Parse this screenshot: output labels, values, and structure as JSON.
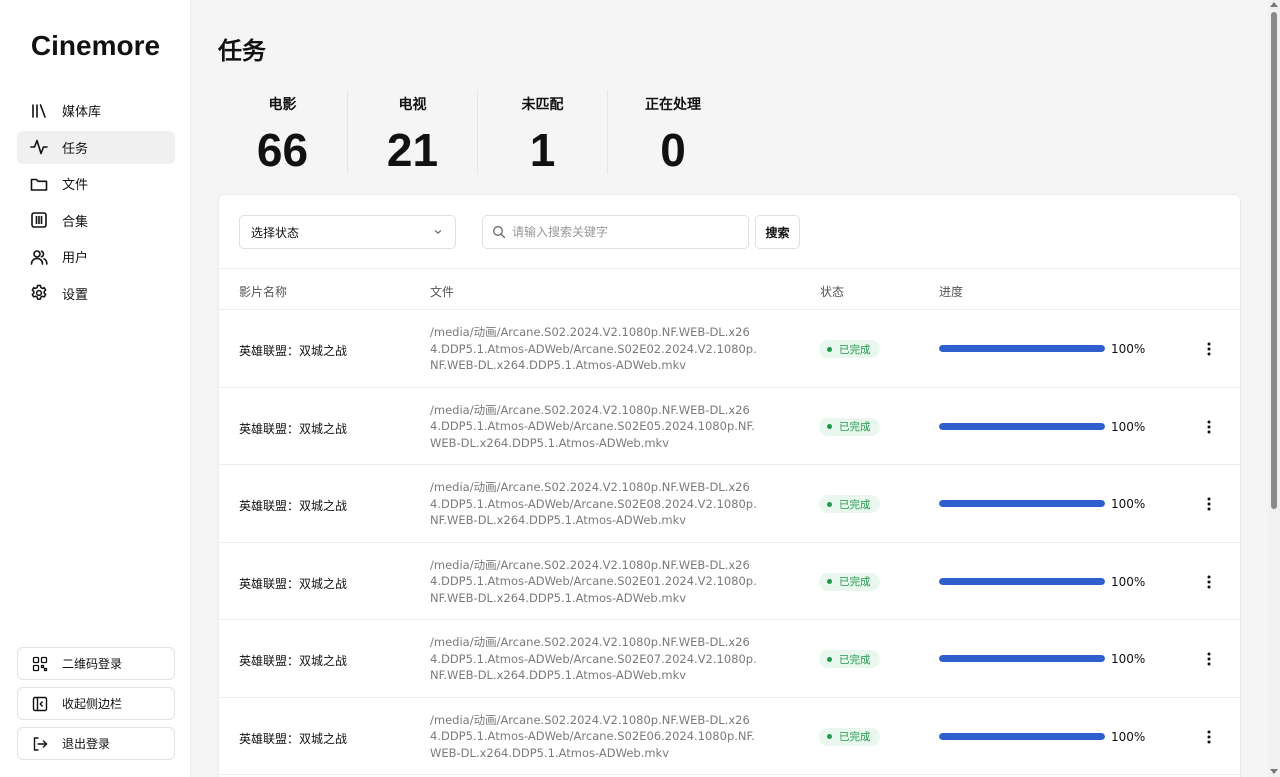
{
  "app": {
    "brand": "Cinemore"
  },
  "sidebar": {
    "items": [
      {
        "label": "媒体库",
        "icon": "library-icon",
        "active": false
      },
      {
        "label": "任务",
        "icon": "activity-icon",
        "active": true
      },
      {
        "label": "文件",
        "icon": "folder-icon",
        "active": false
      },
      {
        "label": "合集",
        "icon": "collection-icon",
        "active": false
      },
      {
        "label": "用户",
        "icon": "users-icon",
        "active": false
      },
      {
        "label": "设置",
        "icon": "gear-icon",
        "active": false
      }
    ],
    "buttons": [
      {
        "label": "二维码登录",
        "icon": "qrcode-icon"
      },
      {
        "label": "收起侧边栏",
        "icon": "collapse-sidebar-icon"
      },
      {
        "label": "退出登录",
        "icon": "logout-icon"
      }
    ]
  },
  "page": {
    "title": "任务"
  },
  "stats": [
    {
      "label": "电影",
      "value": "66"
    },
    {
      "label": "电视",
      "value": "21"
    },
    {
      "label": "未匹配",
      "value": "1"
    },
    {
      "label": "正在处理",
      "value": "0"
    }
  ],
  "toolbar": {
    "status_select": "选择状态",
    "search_placeholder": "请输入搜索关键字",
    "search_button": "搜索"
  },
  "table": {
    "columns": {
      "title": "影片名称",
      "file": "文件",
      "status": "状态",
      "progress": "进度"
    },
    "rows": [
      {
        "title": "英雄联盟：双城之战",
        "file": "/media/动画/Arcane.S02.2024.V2.1080p.NF.WEB-DL.x264.DDP5.1.Atmos-ADWeb/Arcane.S02E02.2024.V2.1080p.NF.WEB-DL.x264.DDP5.1.Atmos-ADWeb.mkv",
        "status": "已完成",
        "progress": 100,
        "progress_text": "100%"
      },
      {
        "title": "英雄联盟：双城之战",
        "file": "/media/动画/Arcane.S02.2024.V2.1080p.NF.WEB-DL.x264.DDP5.1.Atmos-ADWeb/Arcane.S02E05.2024.1080p.NF.WEB-DL.x264.DDP5.1.Atmos-ADWeb.mkv",
        "status": "已完成",
        "progress": 100,
        "progress_text": "100%"
      },
      {
        "title": "英雄联盟：双城之战",
        "file": "/media/动画/Arcane.S02.2024.V2.1080p.NF.WEB-DL.x264.DDP5.1.Atmos-ADWeb/Arcane.S02E08.2024.V2.1080p.NF.WEB-DL.x264.DDP5.1.Atmos-ADWeb.mkv",
        "status": "已完成",
        "progress": 100,
        "progress_text": "100%"
      },
      {
        "title": "英雄联盟：双城之战",
        "file": "/media/动画/Arcane.S02.2024.V2.1080p.NF.WEB-DL.x264.DDP5.1.Atmos-ADWeb/Arcane.S02E01.2024.V2.1080p.NF.WEB-DL.x264.DDP5.1.Atmos-ADWeb.mkv",
        "status": "已完成",
        "progress": 100,
        "progress_text": "100%"
      },
      {
        "title": "英雄联盟：双城之战",
        "file": "/media/动画/Arcane.S02.2024.V2.1080p.NF.WEB-DL.x264.DDP5.1.Atmos-ADWeb/Arcane.S02E07.2024.V2.1080p.NF.WEB-DL.x264.DDP5.1.Atmos-ADWeb.mkv",
        "status": "已完成",
        "progress": 100,
        "progress_text": "100%"
      },
      {
        "title": "英雄联盟：双城之战",
        "file": "/media/动画/Arcane.S02.2024.V2.1080p.NF.WEB-DL.x264.DDP5.1.Atmos-ADWeb/Arcane.S02E06.2024.1080p.NF.WEB-DL.x264.DDP5.1.Atmos-ADWeb.mkv",
        "status": "已完成",
        "progress": 100,
        "progress_text": "100%"
      }
    ]
  },
  "colors": {
    "progress": "#2f5fcf",
    "status_done": "#1e9a4b",
    "status_done_bg": "#eaf7ee"
  }
}
